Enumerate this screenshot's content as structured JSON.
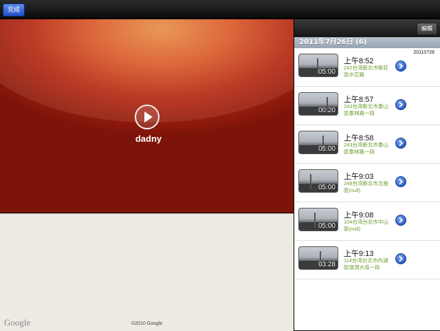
{
  "toolbar": {
    "done_label": "完成"
  },
  "video": {
    "title": "dadny"
  },
  "map": {
    "logo_text": "Google",
    "copyright": "©2010 Google"
  },
  "list_header": {
    "edit_label": "編輯"
  },
  "section": {
    "title": "2011年7月26日 (6)",
    "date_code": "20110726"
  },
  "recordings": [
    {
      "time": "上午8:52",
      "address": "242台湾新北市新莊區中正路",
      "duration": "05:00"
    },
    {
      "time": "上午8:57",
      "address": "243台湾新北市泰山區泰林路一段",
      "duration": "00:20"
    },
    {
      "time": "上午8:58",
      "address": "243台湾新北市泰山區泰林路一段",
      "duration": "05:00"
    },
    {
      "time": "上午9:03",
      "address": "248台湾新北市五股區(null)",
      "duration": "05:00"
    },
    {
      "time": "上午9:08",
      "address": "104台湾台北市中山區(null)",
      "duration": "05:00"
    },
    {
      "time": "上午9:13",
      "address": "114台湾台北市內湖區環頂大道一段",
      "duration": "03:28"
    }
  ]
}
